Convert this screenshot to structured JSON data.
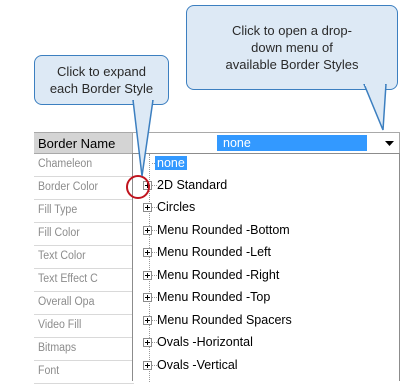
{
  "callouts": {
    "expand": "Click to expand\neach Border Style",
    "dropdown": "Click to open a drop-\ndown menu of\navailable Border Styles"
  },
  "property_grid": {
    "header": "Border Name",
    "rows": [
      "Chameleon",
      "Border Color",
      "Fill Type",
      "Fill Color",
      "Text Color",
      "Text Effect C",
      "Overall Opa",
      "Video Fill",
      "Bitmaps",
      "Font"
    ]
  },
  "combo": {
    "value": "none"
  },
  "dropdown": {
    "items": [
      {
        "label": "none",
        "selected": true
      },
      {
        "label": "2D Standard",
        "expandable": true
      },
      {
        "label": "Circles",
        "expandable": true
      },
      {
        "label": "Menu Rounded -Bottom",
        "expandable": true
      },
      {
        "label": "Menu Rounded -Left",
        "expandable": true
      },
      {
        "label": "Menu Rounded -Right",
        "expandable": true
      },
      {
        "label": "Menu Rounded -Top",
        "expandable": true
      },
      {
        "label": "Menu Rounded Spacers",
        "expandable": true
      },
      {
        "label": "Ovals -Horizontal",
        "expandable": true
      },
      {
        "label": "Ovals -Vertical",
        "expandable": true
      }
    ]
  },
  "colors": {
    "selection": "#3399ff",
    "callout_fill": "#dde9f5",
    "callout_border": "#3c7fc0",
    "highlight_circle": "#c0141e"
  },
  "icons": [
    "dropdown-arrow-icon",
    "expand-plus-icon"
  ]
}
